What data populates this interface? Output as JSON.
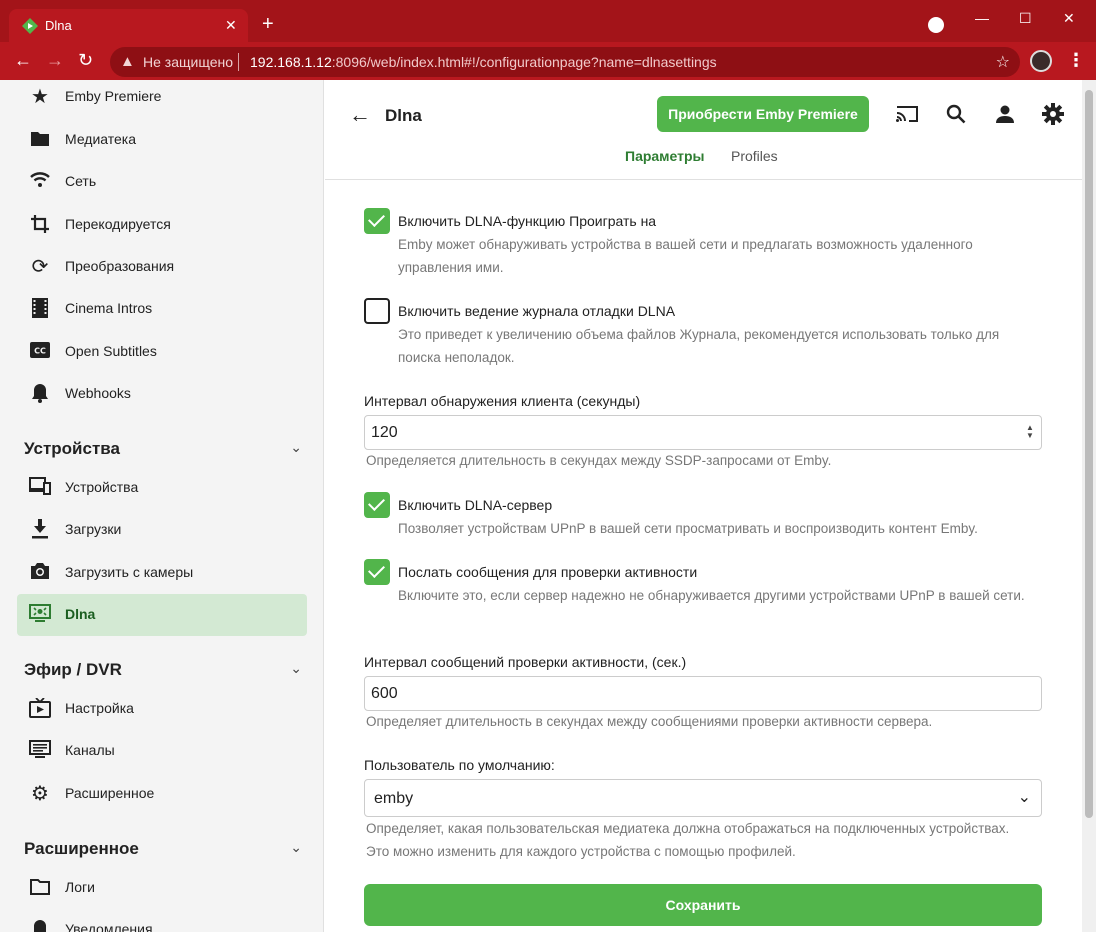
{
  "browser": {
    "tab_title": "Dlna",
    "insecure_label": "Не защищено",
    "url_host": "192.168.1.12",
    "url_path": ":8096/web/index.html#!/configurationpage?name=dlnasettings"
  },
  "sidebar": {
    "items_top": [
      {
        "label": "Emby Premiere",
        "icon": "star-icon"
      },
      {
        "label": "Медиатека",
        "icon": "folder-icon"
      },
      {
        "label": "Сеть",
        "icon": "wifi-icon"
      },
      {
        "label": "Перекодируется",
        "icon": "crop-icon"
      },
      {
        "label": "Преобразования",
        "icon": "sync-icon"
      },
      {
        "label": "Cinema Intros",
        "icon": "film-icon"
      },
      {
        "label": "Open Subtitles",
        "icon": "cc-icon"
      },
      {
        "label": "Webhooks",
        "icon": "bell-icon"
      }
    ],
    "section_devices": "Устройства",
    "items_devices": [
      {
        "label": "Устройства",
        "icon": "devices-icon"
      },
      {
        "label": "Загрузки",
        "icon": "download-icon"
      },
      {
        "label": "Загрузить с камеры",
        "icon": "camera-icon"
      },
      {
        "label": "Dlna",
        "icon": "dlna-icon"
      }
    ],
    "section_dvr": "Эфир / DVR",
    "items_dvr": [
      {
        "label": "Настройка",
        "icon": "tv-icon"
      },
      {
        "label": "Каналы",
        "icon": "list-icon"
      },
      {
        "label": "Расширенное",
        "icon": "gear-icon"
      }
    ],
    "section_advanced": "Расширенное",
    "items_advanced": [
      {
        "label": "Логи",
        "icon": "folder-outline-icon"
      },
      {
        "label": "Уведомления",
        "icon": "bell-icon"
      }
    ]
  },
  "header": {
    "title": "Dlna",
    "premium_button": "Приобрести Emby Premiere",
    "tab_params": "Параметры",
    "tab_profiles": "Profiles"
  },
  "form": {
    "enable_playto_label": "Включить DLNA-функцию Проиграть на",
    "enable_playto_checked": true,
    "enable_playto_desc": "Emby может обнаруживать устройства в вашей сети и предлагать возможность удаленного управления ими.",
    "debug_log_label": "Включить ведение журнала отладки DLNA",
    "debug_log_checked": false,
    "debug_log_desc": "Это приведет к увеличению объема файлов Журнала, рекомендуется использовать только для поиска неполадок.",
    "discovery_label": "Интервал обнаружения клиента (секунды)",
    "discovery_value": "120",
    "discovery_desc": "Определяется длительность в секундах между SSDP-запросами от Emby.",
    "server_label": "Включить DLNA-сервер",
    "server_checked": true,
    "server_desc": "Позволяет устройствам UPnP в вашей сети просматривать и воспроизводить контент Emby.",
    "alive_label": "Послать сообщения для проверки активности",
    "alive_checked": true,
    "alive_desc": "Включите это, если сервер надежно не обнаруживается другими устройствами UPnP в вашей сети.",
    "alive_interval_label": "Интервал сообщений проверки активности, (сек.)",
    "alive_interval_value": "600",
    "alive_interval_desc": "Определяет длительность в секундах между сообщениями проверки активности сервера.",
    "default_user_label": "Пользователь по умолчанию:",
    "default_user_value": "emby",
    "default_user_desc": "Определяет, какая пользовательская медиатека должна отображаться на подключенных устройствах. Это можно изменить для каждого устройства с помощью профилей.",
    "save_button": "Сохранить"
  },
  "colors": {
    "accent": "#52b54b",
    "chrome": "#a31419"
  }
}
